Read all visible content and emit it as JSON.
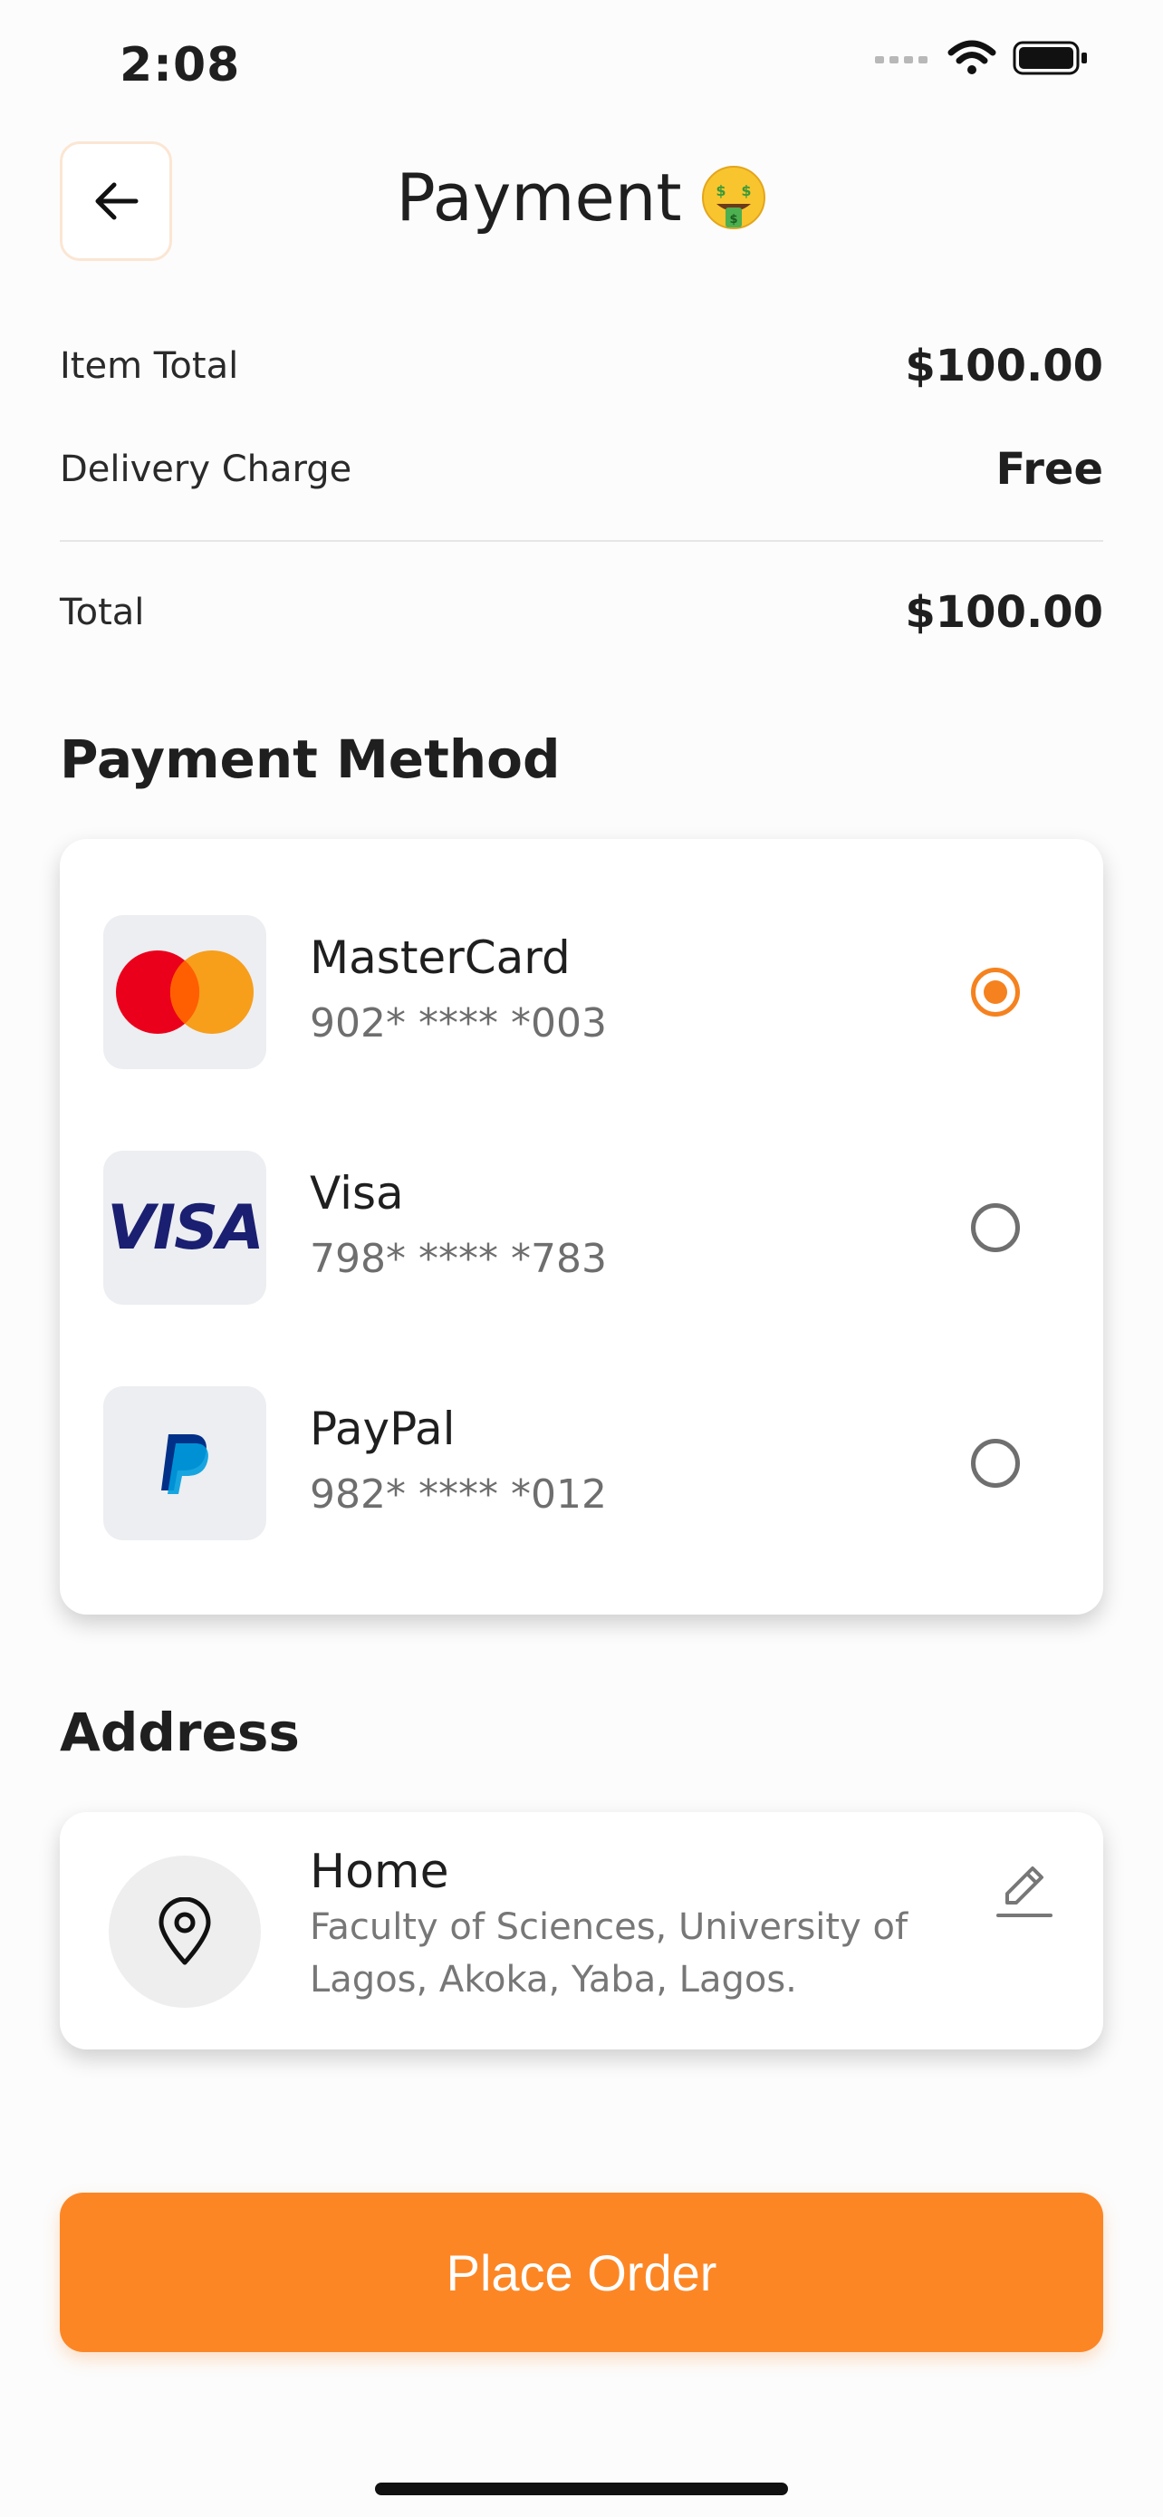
{
  "status_bar": {
    "time": "2:08"
  },
  "header": {
    "title": "Payment",
    "back_icon": "arrow-left-icon",
    "title_icon": "money-mouth-face-emoji"
  },
  "summary": {
    "item_total_label": "Item Total",
    "item_total_value": "$100.00",
    "delivery_label": "Delivery Charge",
    "delivery_value": "Free",
    "total_label": "Total",
    "total_value": "$100.00"
  },
  "payment_method": {
    "title": "Payment Method",
    "methods": [
      {
        "name": "MasterCard",
        "number": "902* **** *003",
        "logo": "mastercard-logo",
        "selected": true
      },
      {
        "name": "Visa",
        "number": "798* **** *783",
        "logo": "visa-logo",
        "selected": false
      },
      {
        "name": "PayPal",
        "number": "982* **** *012",
        "logo": "paypal-logo",
        "selected": false
      }
    ],
    "visa_wordmark": "VISA"
  },
  "address": {
    "title": "Address",
    "name": "Home",
    "text": "Faculty of Sciences, University of Lagos, Akoka, Yaba, Lagos.",
    "icon": "location-pin-icon",
    "edit_icon": "edit-pencil-icon"
  },
  "actions": {
    "place_order": "Place Order"
  },
  "colors": {
    "accent": "#fd8624",
    "radio_selected": "#f5821f",
    "muted_text": "#6e6e6e"
  }
}
